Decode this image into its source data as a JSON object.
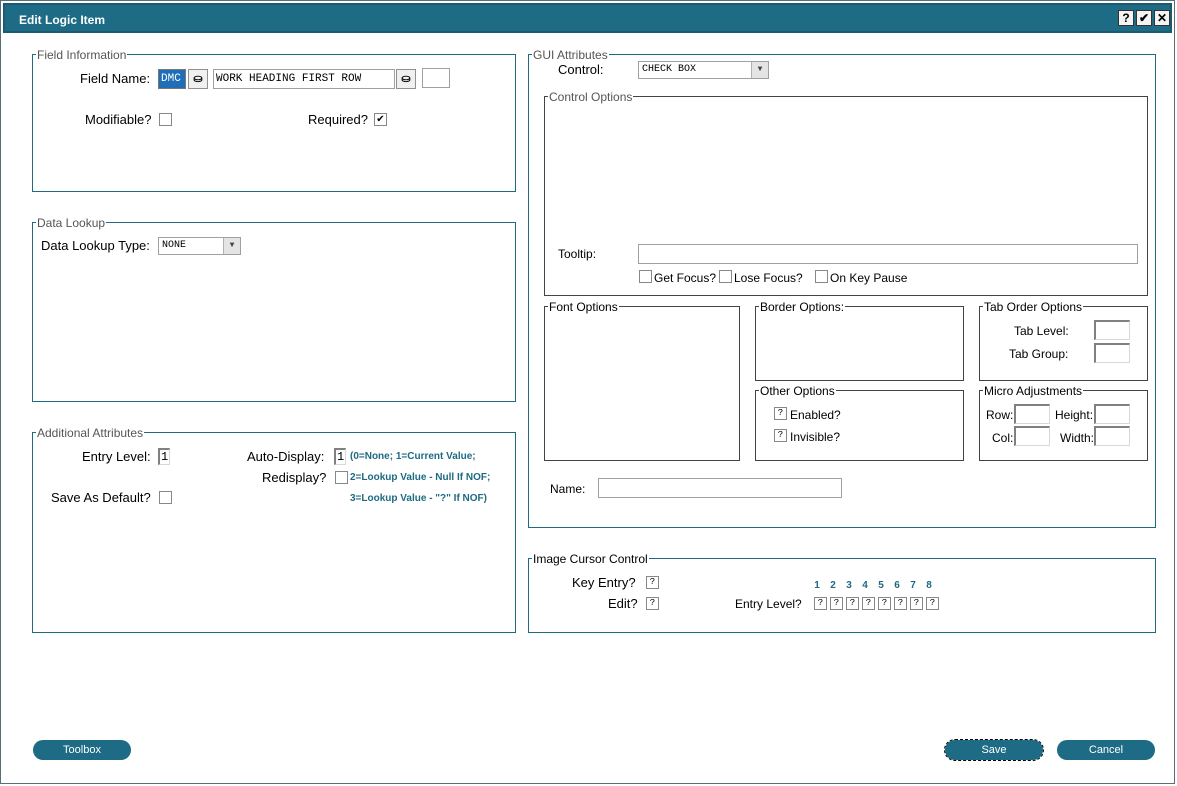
{
  "window": {
    "title": "Edit Logic Item",
    "help_label": "?",
    "ok_label": "✔",
    "close_label": "✕"
  },
  "field_info": {
    "group_label": "Field Information",
    "field_name_label": "Field Name:",
    "field_prefix": "DMC",
    "field_value": "WORK HEADING FIRST ROW",
    "extra_value": "",
    "modifiable_label": "Modifiable?",
    "modifiable_checked": false,
    "required_label": "Required?",
    "required_checked": true
  },
  "data_lookup": {
    "group_label": "Data Lookup",
    "type_label": "Data Lookup Type:",
    "type_value": "NONE"
  },
  "additional": {
    "group_label": "Additional Attributes",
    "entry_level_label": "Entry Level:",
    "entry_level_value": "1",
    "auto_display_label": "Auto-Display:",
    "auto_display_value": "1",
    "redisplay_label": "Redisplay?",
    "save_default_label": "Save As Default?",
    "hint_line1": "(0=None; 1=Current Value;",
    "hint_line2": "2=Lookup Value - Null If NOF;",
    "hint_line3": "3=Lookup Value - \"?\" If NOF)"
  },
  "gui": {
    "group_label": "GUI Attributes",
    "control_label": "Control:",
    "control_value": "CHECK BOX",
    "control_options_label": "Control Options",
    "tooltip_label": "Tooltip:",
    "tooltip_value": "",
    "get_focus_label": "Get Focus?",
    "lose_focus_label": "Lose Focus?",
    "on_key_pause_label": "On Key Pause",
    "font_options_label": "Font Options",
    "border_options_label": "Border Options:",
    "tab_order_label": "Tab Order Options",
    "tab_level_label": "Tab Level:",
    "tab_group_label": "Tab Group:",
    "other_options_label": "Other Options",
    "enabled_label": "Enabled?",
    "enabled_value": "?",
    "invisible_label": "Invisible?",
    "invisible_value": "?",
    "micro_label": "Micro Adjustments",
    "row_label": "Row:",
    "height_label": "Height:",
    "col_label": "Col:",
    "width_label": "Width:",
    "name_label": "Name:",
    "name_value": ""
  },
  "image_cursor": {
    "group_label": "Image Cursor Control",
    "key_entry_label": "Key Entry?",
    "key_entry_value": "?",
    "edit_label": "Edit?",
    "edit_value": "?",
    "entry_level_label": "Entry Level?",
    "levels": [
      "1",
      "2",
      "3",
      "4",
      "5",
      "6",
      "7",
      "8"
    ],
    "level_values": [
      "?",
      "?",
      "?",
      "?",
      "?",
      "?",
      "?",
      "?"
    ]
  },
  "footer": {
    "toolbox_label": "Toolbox",
    "save_label": "Save",
    "cancel_label": "Cancel"
  }
}
